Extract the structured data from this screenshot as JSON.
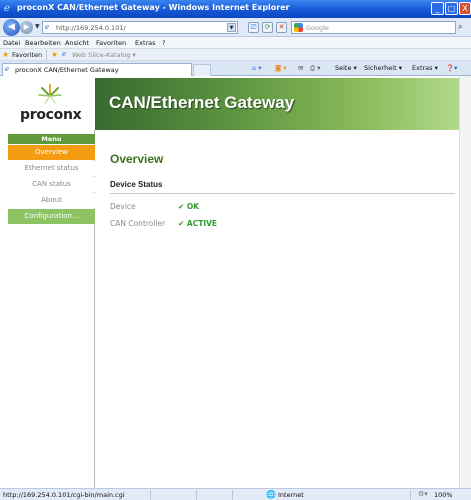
{
  "window": {
    "title": "proconX CAN/Ethernet Gateway - Windows Internet Explorer",
    "controls": {
      "minimize": "_",
      "maximize": "□",
      "close": "X"
    }
  },
  "address": {
    "url": "http://169.254.0.101/",
    "search_placeholder": "Google"
  },
  "menu": [
    "Datei",
    "Bearbeiten",
    "Ansicht",
    "Favoriten",
    "Extras",
    "?"
  ],
  "favorites": {
    "label": "Favoriten",
    "webslice": "Web Slice-Katalog ▾"
  },
  "tab": {
    "label": "proconX CAN/Ethernet Gateway"
  },
  "commands": [
    "Seite ▾",
    "Sicherheit ▾",
    "Extras ▾"
  ],
  "page": {
    "logo": "proconx",
    "header_title": "CAN/Ethernet Gateway",
    "sidebar": {
      "menu_label": "Menu",
      "items": [
        {
          "label": "Overview",
          "state": "active"
        },
        {
          "label": "Ethernet status",
          "state": "normal"
        },
        {
          "label": "CAN status",
          "state": "normal"
        },
        {
          "label": "About",
          "state": "normal"
        },
        {
          "label": "Configuration...",
          "state": "config"
        }
      ]
    },
    "content": {
      "title": "Overview",
      "section": "Device Status",
      "rows": [
        {
          "label": "Device",
          "value": "✔ OK"
        },
        {
          "label": "CAN Controller",
          "value": "✔ ACTIVE"
        }
      ]
    }
  },
  "status": {
    "url": "http://169.254.0.101/cgi-bin/main.cgi",
    "zone": "Internet",
    "zoom": "100%"
  },
  "colors": {
    "header_green": "#5f9641",
    "active_orange": "#f39c12",
    "config_green": "#8dc363",
    "ok_green": "#2f9b2f",
    "title_green": "#3c7220"
  }
}
